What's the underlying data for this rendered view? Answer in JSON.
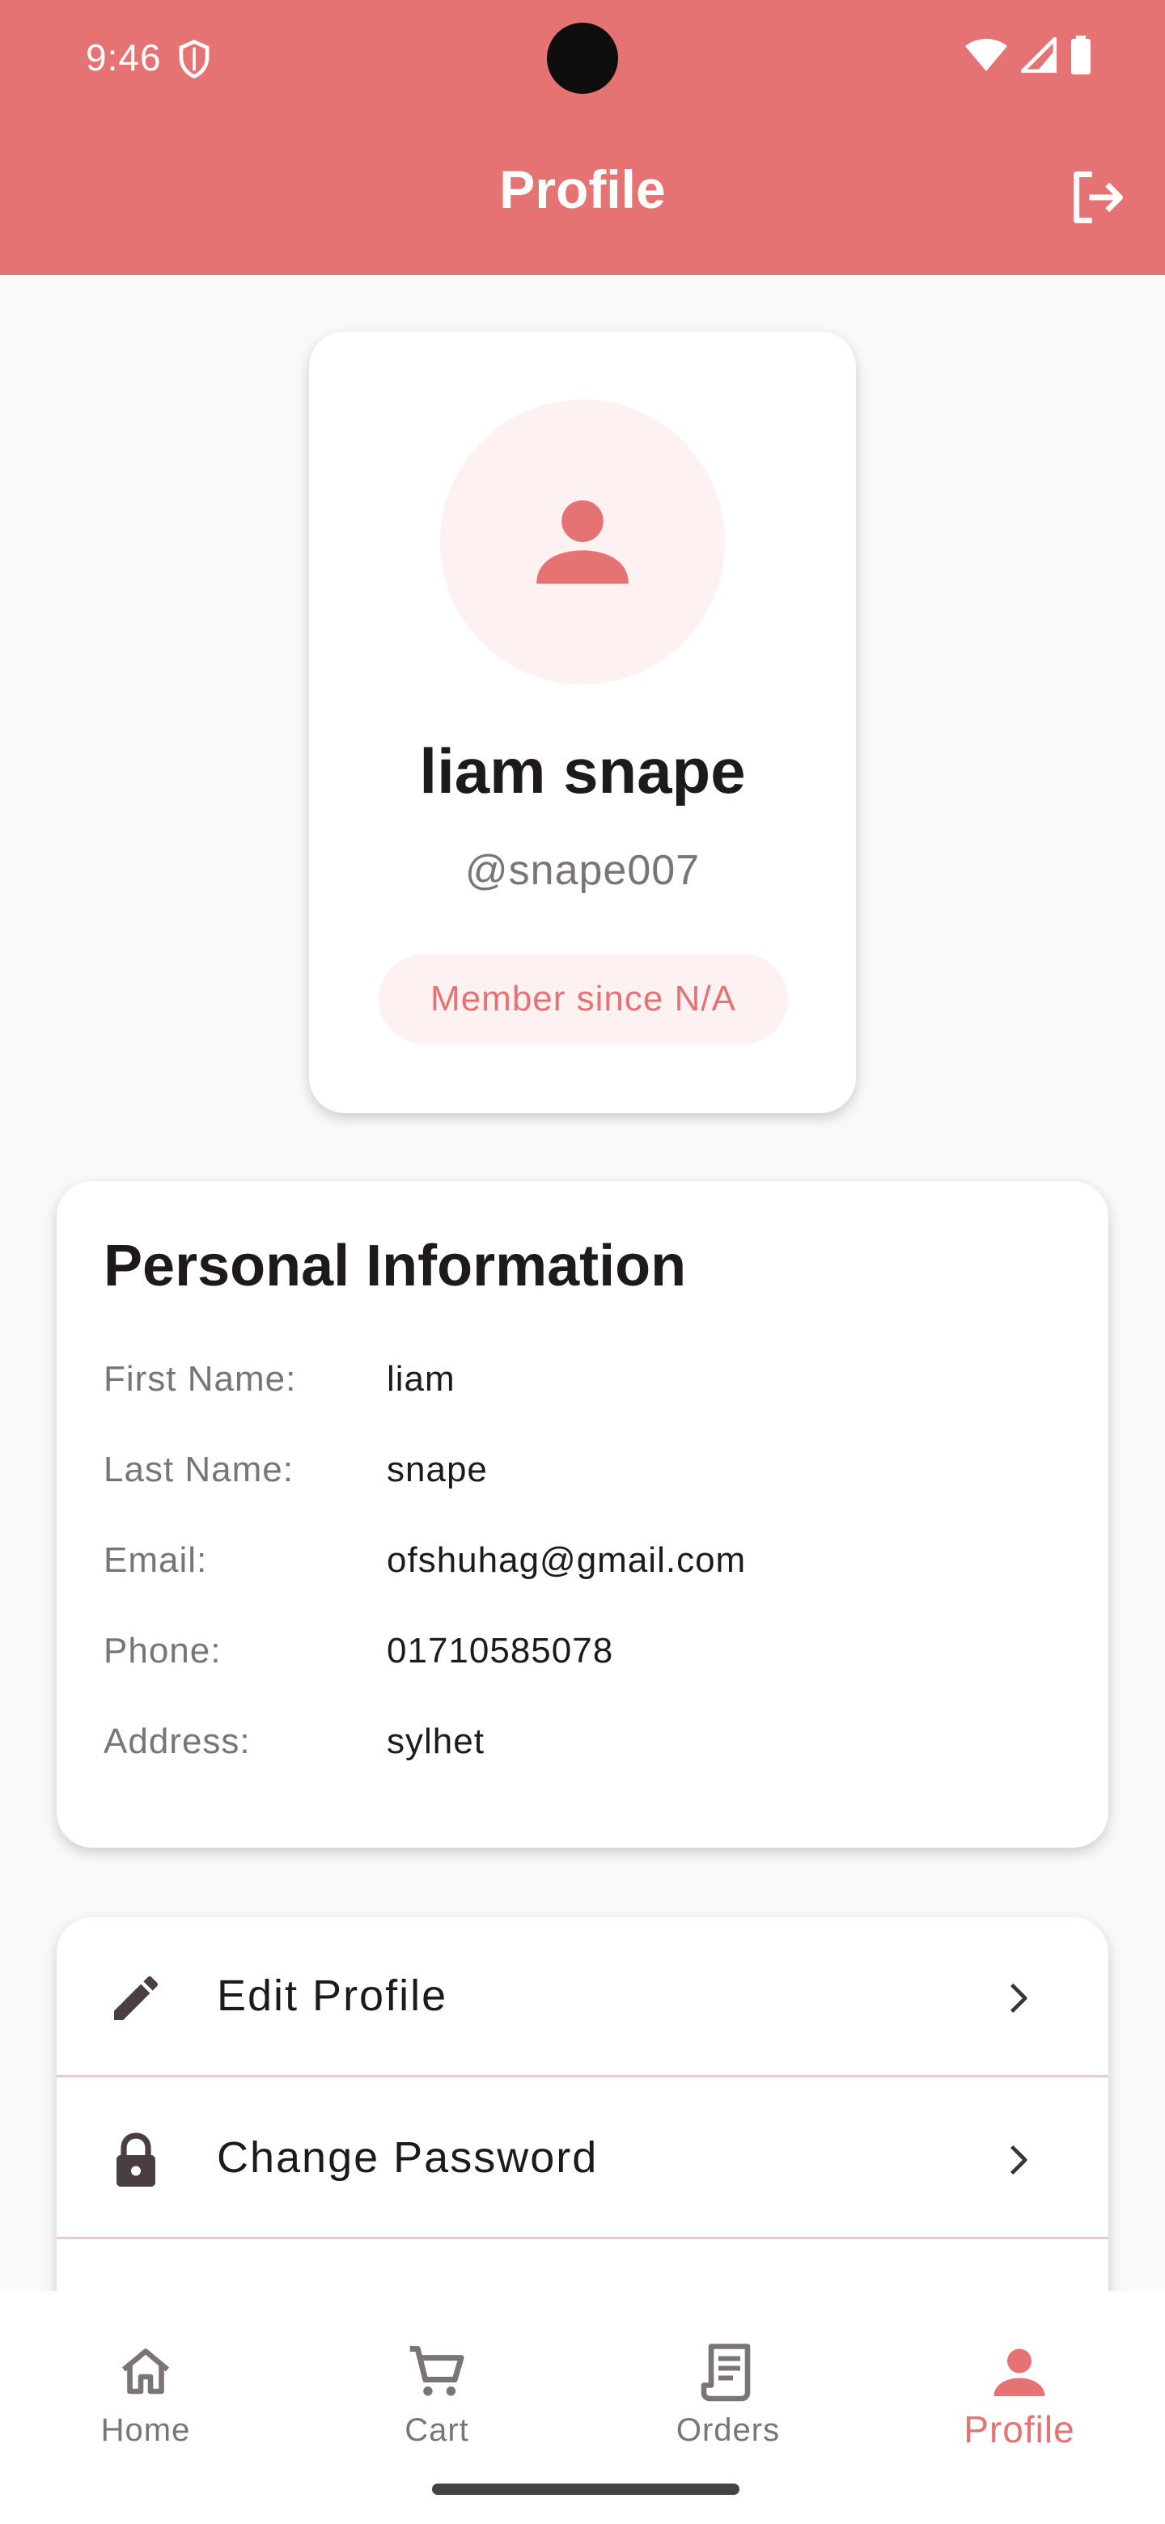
{
  "status_bar": {
    "time": "9:46"
  },
  "app_bar": {
    "title": "Profile"
  },
  "profile": {
    "name": "liam snape",
    "username": "@snape007",
    "member_since": "Member since N/A"
  },
  "personal_info": {
    "title": "Personal Information",
    "rows": [
      {
        "label": "First Name:",
        "value": "liam"
      },
      {
        "label": "Last Name:",
        "value": "snape"
      },
      {
        "label": "Email:",
        "value": "ofshuhag@gmail.com"
      },
      {
        "label": "Phone:",
        "value": "01710585078"
      },
      {
        "label": "Address:",
        "value": "sylhet"
      }
    ]
  },
  "actions": [
    {
      "label": "Edit Profile",
      "icon": "pencil-icon"
    },
    {
      "label": "Change Password",
      "icon": "lock-icon"
    }
  ],
  "bottom_nav": {
    "items": [
      {
        "label": "Home",
        "icon": "home-icon"
      },
      {
        "label": "Cart",
        "icon": "cart-icon"
      },
      {
        "label": "Orders",
        "icon": "receipt-icon"
      },
      {
        "label": "Profile",
        "icon": "person-icon"
      }
    ],
    "active": "Profile"
  },
  "colors": {
    "primary": "#E57373",
    "avatar_bg": "#FDF1F1",
    "background": "#F9F9F9",
    "text": "#1E1A1A",
    "muted_text": "#7A7474",
    "divider": "#E8C9CE"
  }
}
